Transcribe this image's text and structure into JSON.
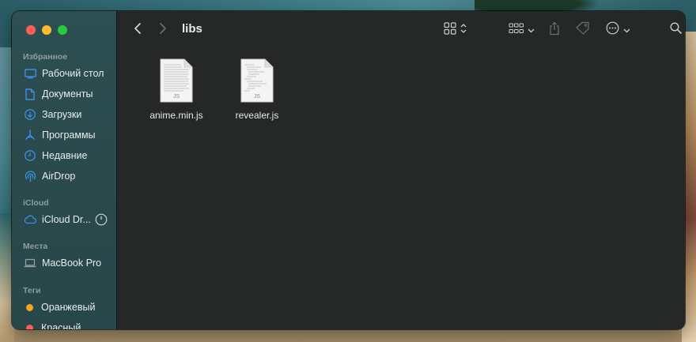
{
  "window": {
    "title": "libs"
  },
  "sidebar": {
    "sections": [
      {
        "title": "Избранное",
        "items": [
          {
            "label": "Рабочий стол",
            "icon": "desktop-icon"
          },
          {
            "label": "Документы",
            "icon": "document-icon"
          },
          {
            "label": "Загрузки",
            "icon": "download-icon"
          },
          {
            "label": "Программы",
            "icon": "applications-icon"
          },
          {
            "label": "Недавние",
            "icon": "clock-icon"
          },
          {
            "label": "AirDrop",
            "icon": "airdrop-icon"
          }
        ]
      },
      {
        "title": "iCloud",
        "items": [
          {
            "label": "iCloud Dr...",
            "icon": "cloud-icon"
          }
        ]
      },
      {
        "title": "Места",
        "items": [
          {
            "label": "MacBook Pro",
            "icon": "laptop-icon"
          }
        ]
      },
      {
        "title": "Теги",
        "items": [
          {
            "label": "Оранжевый",
            "color": "#f5a623"
          },
          {
            "label": "Красный",
            "color": "#ff5b57"
          }
        ]
      }
    ]
  },
  "files": [
    {
      "name": "anime.min.js",
      "badge": "JS"
    },
    {
      "name": "revealer.js",
      "badge": "JS"
    }
  ],
  "colors": {
    "accent": "#3d8ee5",
    "traffic_red": "#ff5f57",
    "traffic_yellow": "#febc2e",
    "traffic_green": "#28c840"
  }
}
